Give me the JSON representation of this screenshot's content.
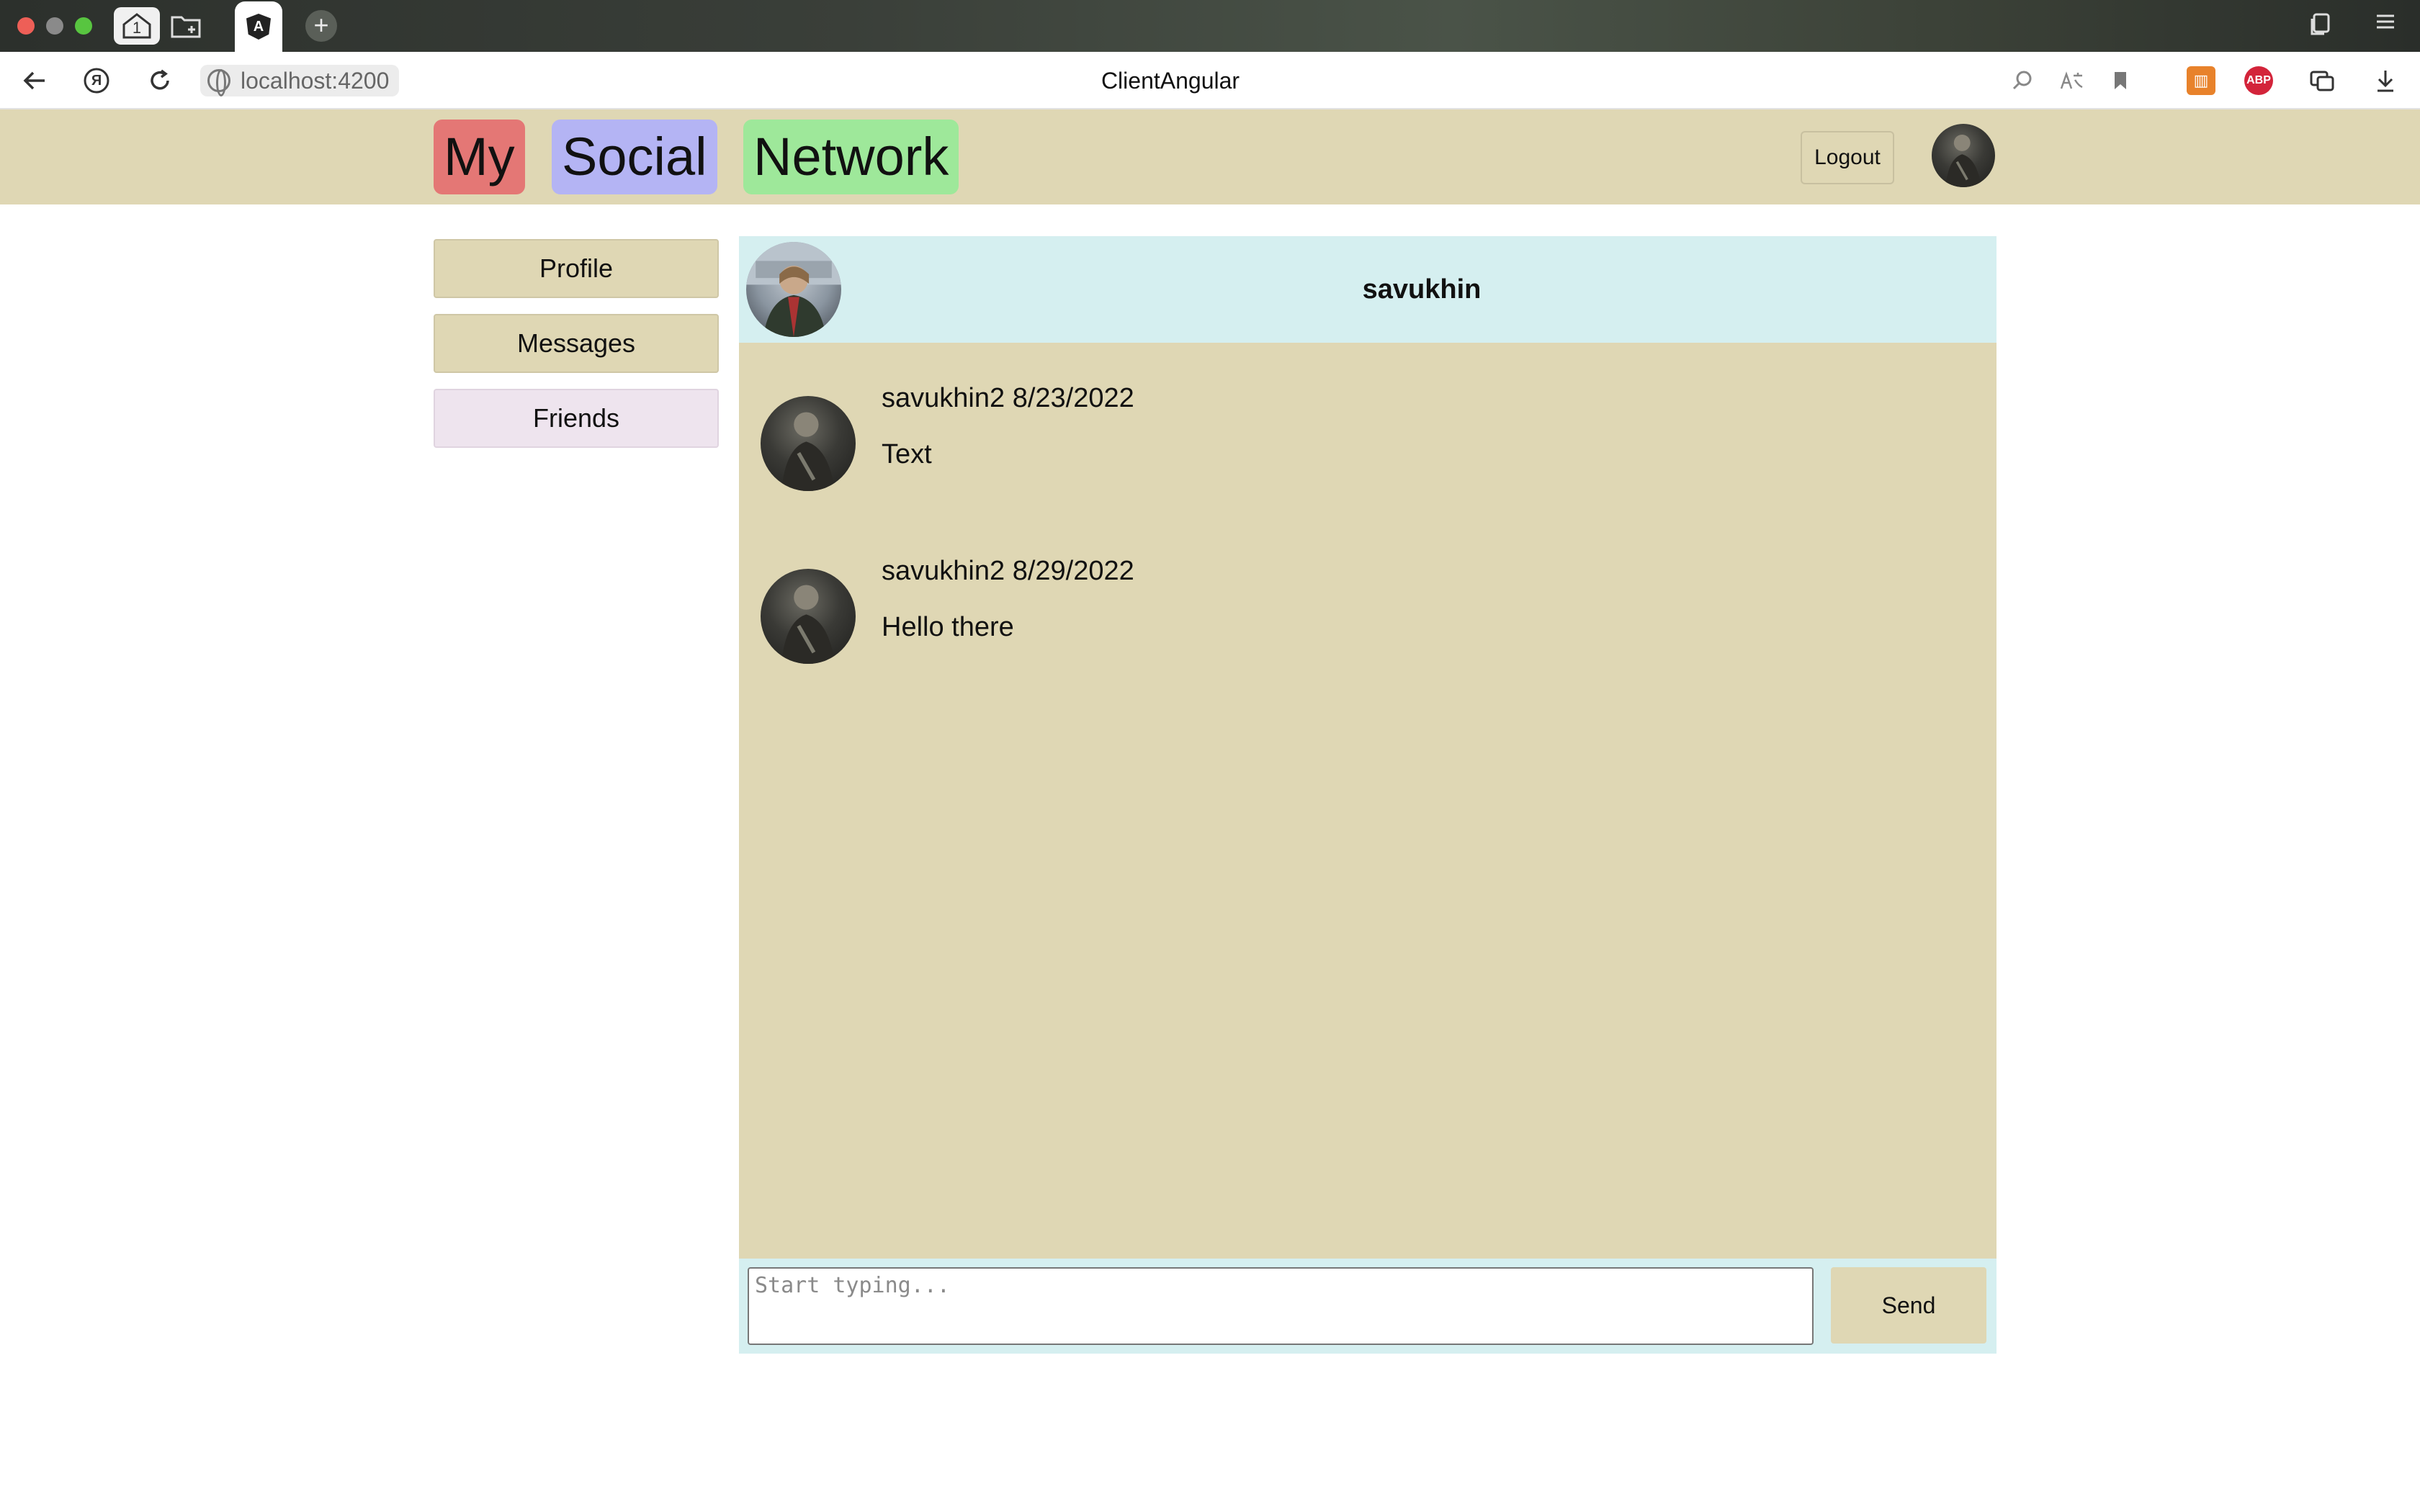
{
  "browser": {
    "tab_home_label": "1",
    "new_tab_label": "+",
    "url": "localhost:4200",
    "page_title": "ClientAngular",
    "tab_logo_letter": "A",
    "ya_letter": "Я",
    "extensions": {
      "books_label": "▥",
      "abp_label": "ABP"
    }
  },
  "header": {
    "brand": [
      "My",
      "Social",
      "Network"
    ],
    "logout_label": "Logout"
  },
  "sidebar": {
    "items": [
      {
        "label": "Profile"
      },
      {
        "label": "Messages"
      },
      {
        "label": "Friends"
      }
    ]
  },
  "chat": {
    "partner_name": "savukhin",
    "messages": [
      {
        "author": "savukhin2",
        "date": "8/23/2022",
        "text": "Text"
      },
      {
        "author": "savukhin2",
        "date": "8/29/2022",
        "text": "Hello there"
      }
    ],
    "input_placeholder": "Start typing...",
    "input_value": "",
    "send_label": "Send"
  },
  "colors": {
    "header_bg": "#dfd7b4",
    "brand_my": "#e47775",
    "brand_social": "#b4b4f4",
    "brand_network": "#9ee89a",
    "chat_head_bg": "#d5eff0",
    "friends_btn_bg": "#eee4ee"
  }
}
